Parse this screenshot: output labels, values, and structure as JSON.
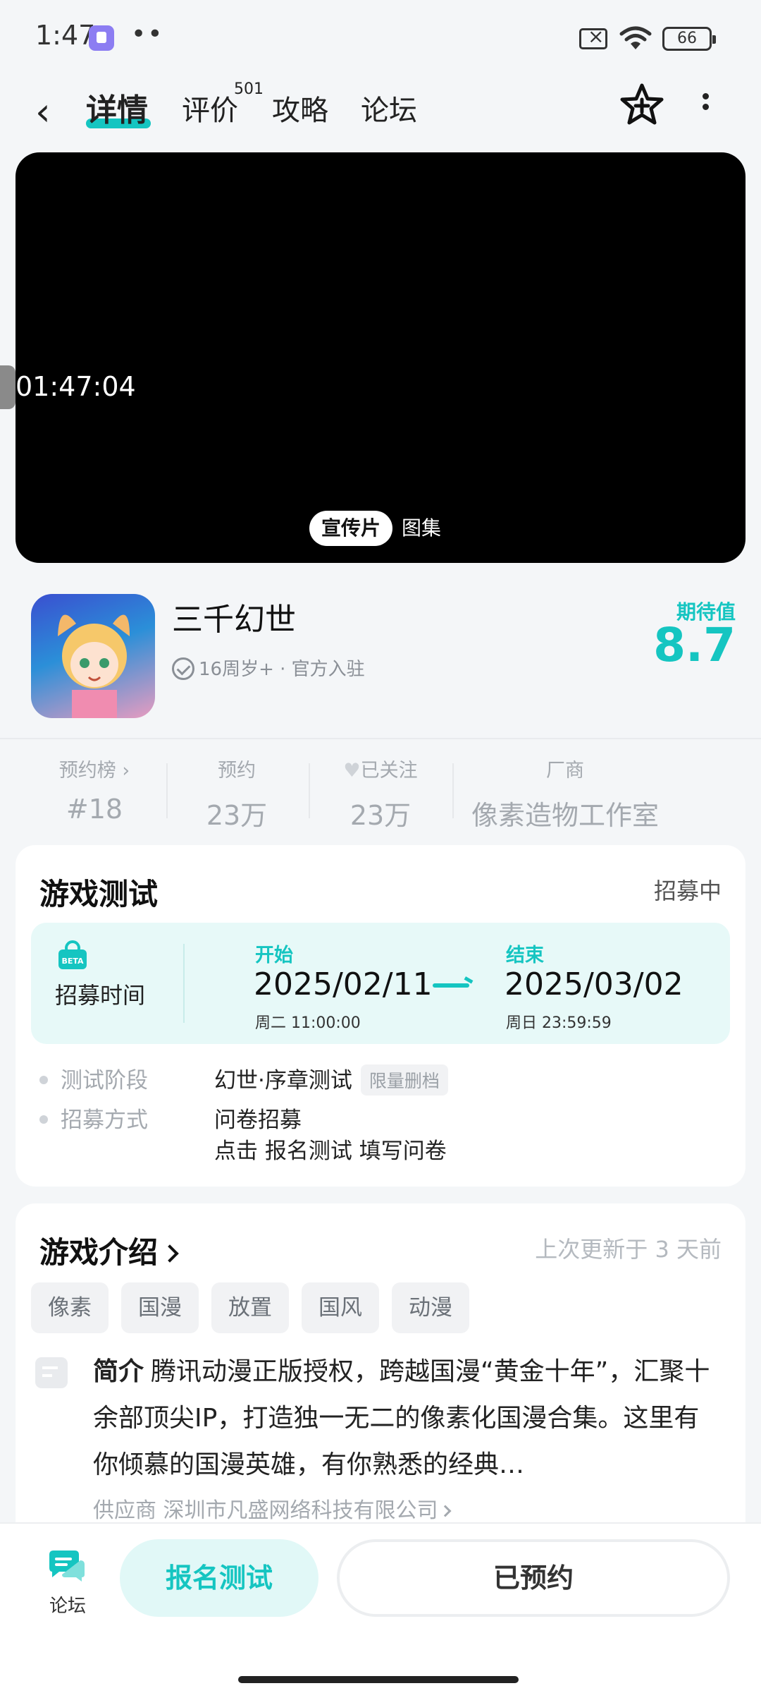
{
  "status": {
    "time": "1:47",
    "battery": "66"
  },
  "nav": {
    "tabs": [
      "详情",
      "评价",
      "攻略",
      "论坛"
    ],
    "review_count": "501"
  },
  "video": {
    "timestamp": "01:47:04",
    "tab_active": "宣传片",
    "tab_other": "图集"
  },
  "game": {
    "title": "三千幻世",
    "meta": "16周岁+ · 官方入驻",
    "expect_label": "期待值",
    "expect_value": "8.7"
  },
  "stats": [
    {
      "label": "预约榜",
      "value": "#18"
    },
    {
      "label": "预约",
      "value": "23万"
    },
    {
      "label": "已关注",
      "value": "23万"
    },
    {
      "label": "厂商",
      "value": "像素造物工作室"
    }
  ],
  "test": {
    "title": "游戏测试",
    "status": "招募中",
    "recruit_label": "招募时间",
    "start_label": "开始",
    "start_date": "2025/02/11",
    "start_sub": "周二  11:00:00",
    "end_label": "结束",
    "end_date": "2025/03/02",
    "end_sub": "周日  23:59:59",
    "stage_key": "测试阶段",
    "stage_value": "幻世·序章测试",
    "stage_tag": "限量删档",
    "method_key": "招募方式",
    "method_value": "问卷招募",
    "method_detail": "点击 报名测试 填写问卷"
  },
  "intro": {
    "title": "游戏介绍",
    "updated": "上次更新于 3 天前",
    "tags": [
      "像素",
      "国漫",
      "放置",
      "国风",
      "动漫"
    ],
    "prefix": "简介",
    "text": "腾讯动漫正版授权，跨越国漫“黄金十年”，汇聚十余部顶尖IP，打造独一无二的像素化国漫合集。这里有你倾慕的国漫英雄，有你熟悉的经典…",
    "supplier": "供应商  深圳市凡盛网络科技有限公司"
  },
  "bottom": {
    "forum_label": "论坛",
    "join_label": "报名测试",
    "booked_label": "已预约"
  },
  "colors": {
    "accent": "#15c5c1"
  }
}
